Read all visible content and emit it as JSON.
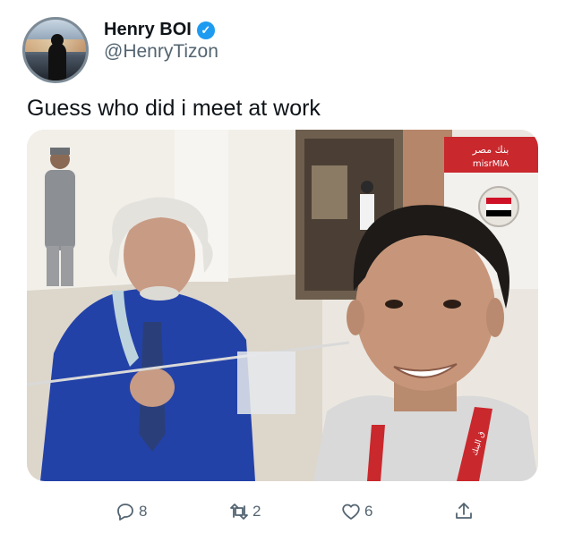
{
  "tweet": {
    "display_name": "Henry BOI",
    "handle": "@HenryTizon",
    "verified_icon": "verified-badge-icon",
    "text": "Guess who did i meet at work"
  },
  "media": {
    "description_icon": "photo",
    "sign_text_1": "بنك مصر",
    "sign_text_2": "misrMIA",
    "lanyard_text": "ق البنك"
  },
  "actions": {
    "reply_count": "8",
    "retweet_count": "2",
    "like_count": "6"
  },
  "colors": {
    "accent": "#1d9bf0",
    "text_primary": "#0f1419",
    "text_secondary": "#536471"
  }
}
